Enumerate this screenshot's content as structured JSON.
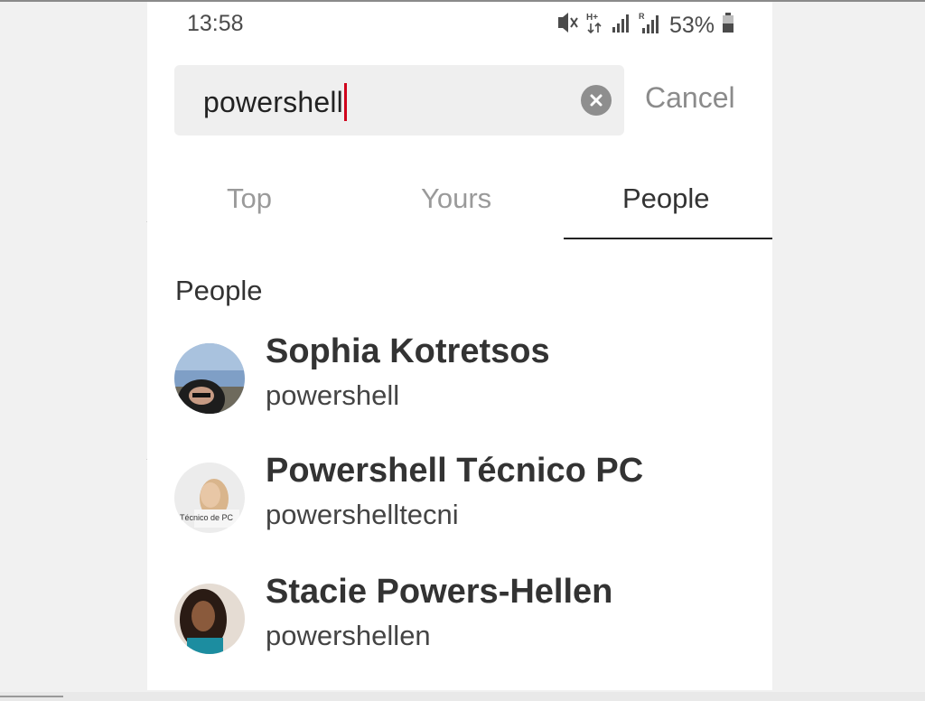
{
  "status_bar": {
    "time": "13:58",
    "battery_percent": "53%",
    "icons": [
      "mute-vibrate-icon",
      "hplus-data-icon",
      "signal-icon",
      "roaming-signal-icon",
      "battery-icon"
    ]
  },
  "search": {
    "value": "powershell",
    "cancel_label": "Cancel",
    "clear_icon": "clear-icon"
  },
  "tabs": [
    {
      "label": "Top",
      "active": false
    },
    {
      "label": "Yours",
      "active": false
    },
    {
      "label": "People",
      "active": true
    }
  ],
  "people_section": {
    "title": "People",
    "items": [
      {
        "name": "Sophia Kotretsos",
        "handle": "powershell"
      },
      {
        "name": "Powershell Técnico PC",
        "handle": "powershelltecni",
        "avatar_text": "Técnico de PC"
      },
      {
        "name": "Stacie Powers-Hellen",
        "handle": "powershellen"
      }
    ]
  },
  "colors": {
    "caret": "#d0021b",
    "active_tab": "#333333",
    "inactive_tab": "#9a9a9a",
    "search_bg": "#efefef"
  }
}
